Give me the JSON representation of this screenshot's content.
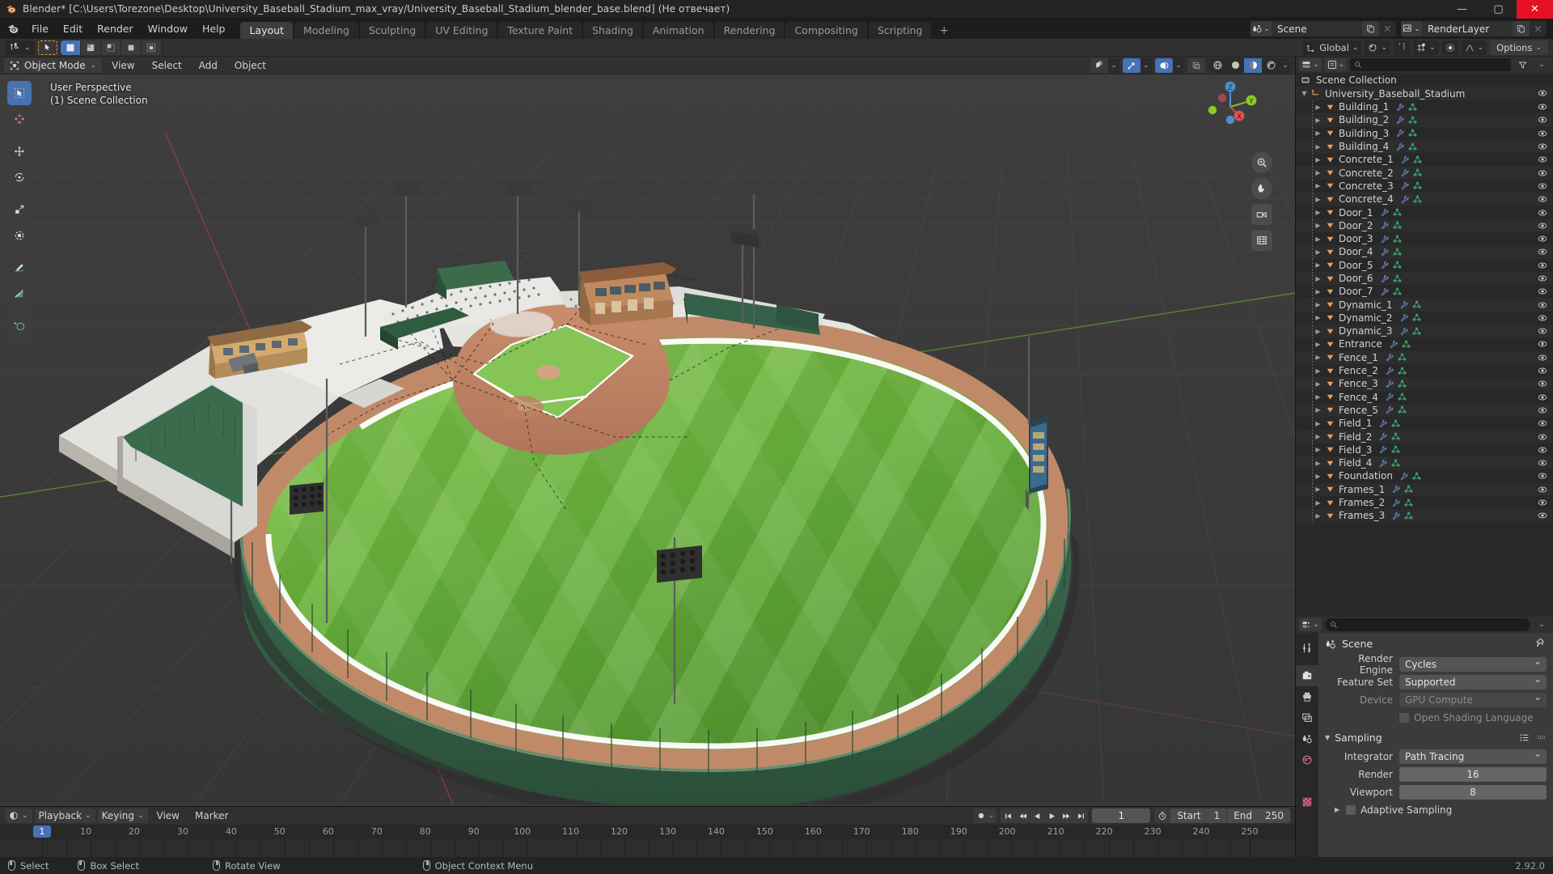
{
  "window": {
    "title": "Blender* [C:\\Users\\Torezone\\Desktop\\University_Baseball_Stadium_max_vray/University_Baseball_Stadium_blender_base.blend] (Не отвечает)",
    "minimize": "—",
    "maximize": "▢",
    "close": "✕"
  },
  "topbar": {
    "menus": [
      "File",
      "Edit",
      "Render",
      "Window",
      "Help"
    ],
    "workspaces": [
      "Layout",
      "Modeling",
      "Sculpting",
      "UV Editing",
      "Texture Paint",
      "Shading",
      "Animation",
      "Rendering",
      "Compositing",
      "Scripting"
    ],
    "active_workspace": "Layout",
    "add_workspace": "+",
    "scene_name": "Scene",
    "viewlayer_name": "RenderLayer"
  },
  "tool_settings": {
    "transform_orientation": "Global",
    "options_label": "Options"
  },
  "viewport": {
    "mode": "Object Mode",
    "menus": [
      "View",
      "Select",
      "Add",
      "Object"
    ],
    "overlay_line1": "User Perspective",
    "overlay_line2": "(1) Scene Collection",
    "gizmo_axes": {
      "x": "X",
      "y": "Y",
      "z": "Z"
    },
    "tools": [
      "tweak-select-tool",
      "cursor-tool",
      "move-tool",
      "rotate-tool",
      "scale-tool",
      "transform-tool",
      "annotate-tool",
      "measure-tool",
      "add-cube-tool"
    ]
  },
  "outliner": {
    "display_mode": "View Layer",
    "search_placeholder": "",
    "root": "Scene Collection",
    "collection": "University_Baseball_Stadium",
    "objects": [
      "Building_1",
      "Building_2",
      "Building_3",
      "Building_4",
      "Concrete_1",
      "Concrete_2",
      "Concrete_3",
      "Concrete_4",
      "Door_1",
      "Door_2",
      "Door_3",
      "Door_4",
      "Door_5",
      "Door_6",
      "Door_7",
      "Dynamic_1",
      "Dynamic_2",
      "Dynamic_3",
      "Entrance",
      "Fence_1",
      "Fence_2",
      "Fence_3",
      "Fence_4",
      "Fence_5",
      "Field_1",
      "Field_2",
      "Field_3",
      "Field_4",
      "Foundation",
      "Frames_1",
      "Frames_2",
      "Frames_3"
    ]
  },
  "properties": {
    "context_title": "Scene",
    "render_engine_label": "Render Engine",
    "render_engine_value": "Cycles",
    "feature_set_label": "Feature Set",
    "feature_set_value": "Supported",
    "device_label": "Device",
    "device_value": "GPU Compute",
    "osl_label": "Open Shading Language",
    "sampling_label": "Sampling",
    "integrator_label": "Integrator",
    "integrator_value": "Path Tracing",
    "render_samples_label": "Render",
    "render_samples_value": "16",
    "viewport_samples_label": "Viewport",
    "viewport_samples_value": "8",
    "adaptive_sampling_label": "Adaptive Sampling",
    "version": "2.92.0",
    "tabs": [
      "tool",
      "render",
      "output",
      "view-layer",
      "scene",
      "world",
      "object",
      "material"
    ]
  },
  "timeline": {
    "editor_type": "Timeline",
    "menus_drop": [
      "Playback",
      "Keying"
    ],
    "menus": [
      "View",
      "Marker"
    ],
    "current_frame": "1",
    "start_label": "Start",
    "start_value": "1",
    "end_label": "End",
    "end_value": "250",
    "ticks": [
      "1",
      "10",
      "20",
      "30",
      "40",
      "50",
      "60",
      "70",
      "80",
      "90",
      "100",
      "110",
      "120",
      "130",
      "140",
      "150",
      "160",
      "170",
      "180",
      "190",
      "200",
      "210",
      "220",
      "230",
      "240",
      "250"
    ]
  },
  "statusbar": {
    "items": [
      {
        "mouse": "left",
        "label": "Select"
      },
      {
        "mouse": "left-drag",
        "label": "Box Select"
      },
      {
        "mouse": "mid",
        "label": "Rotate View"
      },
      {
        "mouse": "right",
        "label": "Object Context Menu"
      }
    ],
    "version": "2.92.0"
  },
  "colors": {
    "accent": "#4772b3",
    "close": "#e81123",
    "object_orange": "#ed9e5c",
    "mesh_green": "#3bb273"
  }
}
